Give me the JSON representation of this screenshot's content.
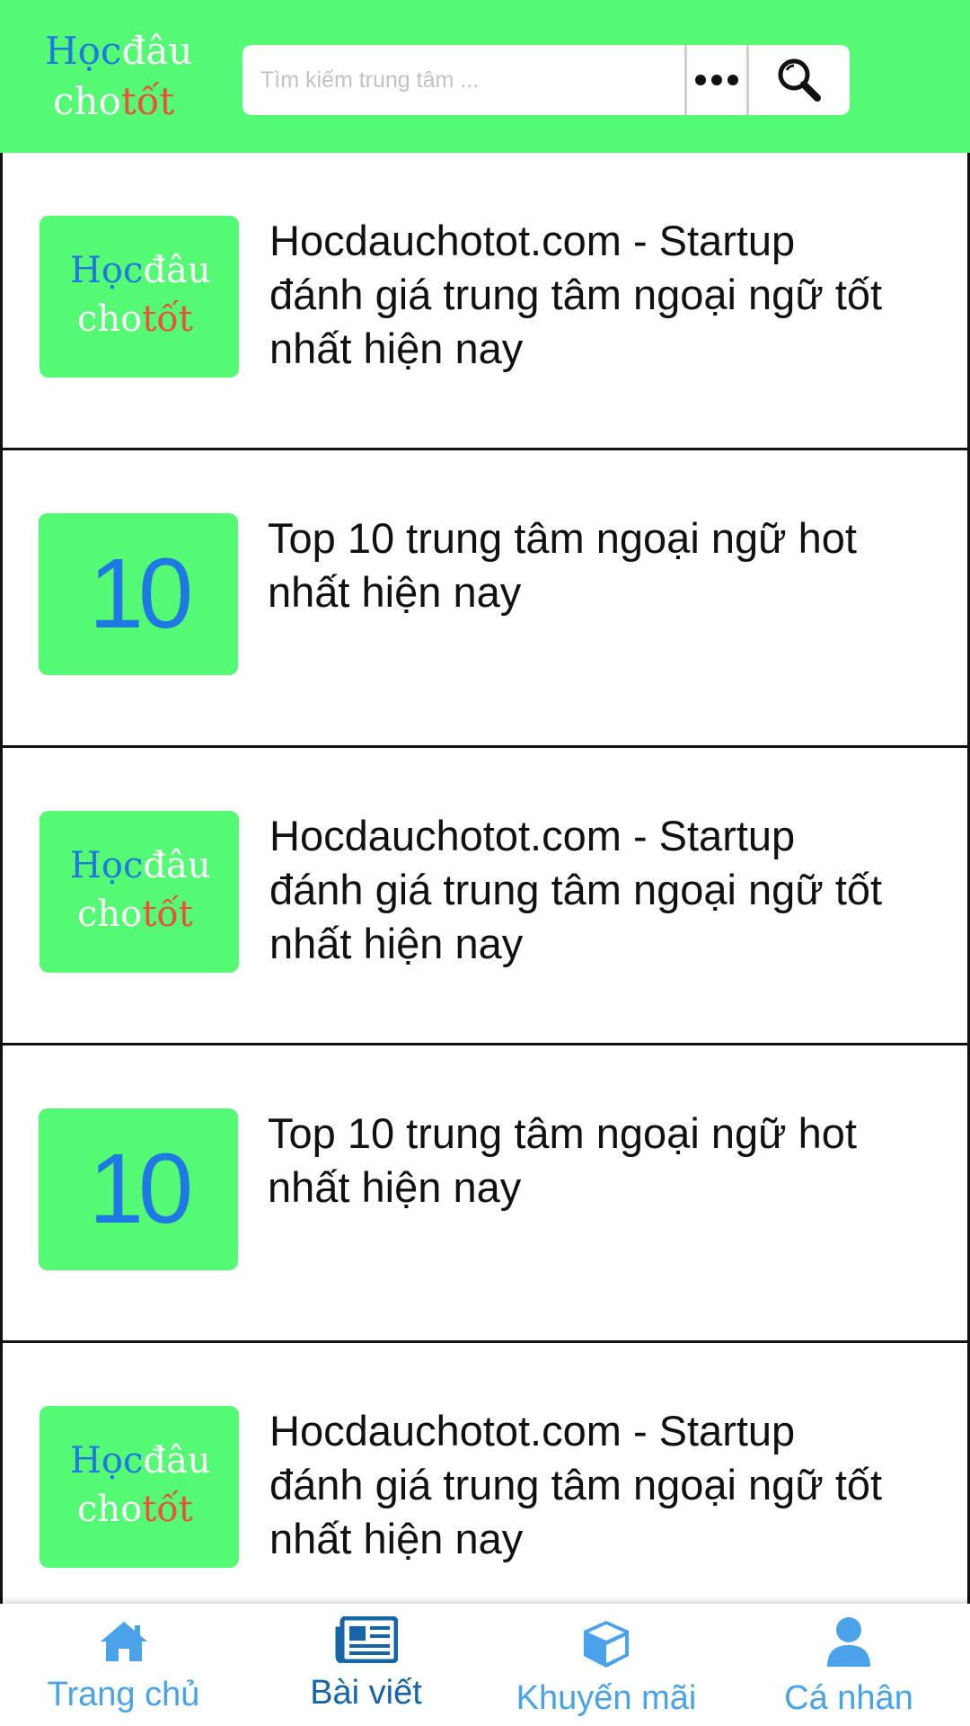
{
  "header": {
    "logo": {
      "line1_a": "Học",
      "line1_b": "đâu",
      "line2_a": "cho",
      "line2_b": "tốt"
    },
    "search": {
      "placeholder": "Tìm kiếm trung tâm ..."
    },
    "more_icon": "more-dots-icon",
    "search_icon": "magnifier-icon"
  },
  "posts": [
    {
      "thumb": "logo",
      "title": "Hocdauchotot.com - Startup đánh giá trung tâm ngoại ngữ tốt nhất hiện nay"
    },
    {
      "thumb": "ten",
      "thumb_text": "10",
      "title": "Top 10 trung tâm ngoại ngữ hot nhất hiện nay"
    },
    {
      "thumb": "logo",
      "title": "Hocdauchotot.com - Startup đánh giá trung tâm ngoại ngữ tốt nhất hiện nay"
    },
    {
      "thumb": "ten",
      "thumb_text": "10",
      "title": "Top 10 trung tâm ngoại ngữ hot nhất hiện nay"
    },
    {
      "thumb": "logo",
      "title": "Hocdauchotot.com - Startup đánh giá trung tâm ngoại ngữ tốt nhất hiện nay"
    }
  ],
  "nav": {
    "items": [
      {
        "label": "Trang chủ",
        "icon": "home-icon",
        "active": false
      },
      {
        "label": "Bài viết",
        "icon": "newspaper-icon",
        "active": true
      },
      {
        "label": "Khuyến mãi",
        "icon": "box-icon",
        "active": false
      },
      {
        "label": "Cá nhân",
        "icon": "user-icon",
        "active": false
      }
    ]
  },
  "colors": {
    "brand_green": "#54fa73",
    "brand_blue": "#1e7ae2",
    "brand_red": "#f04d3a",
    "nav_inactive": "#4aa3e8",
    "nav_active": "#1565a8"
  }
}
